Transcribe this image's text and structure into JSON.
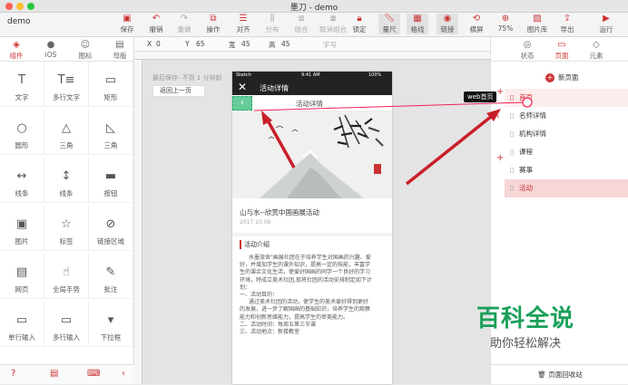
{
  "window": {
    "title": "墨刀 - demo",
    "project": "demo"
  },
  "toolbar": {
    "items": [
      {
        "label": "保存",
        "icon": "save-icon"
      },
      {
        "label": "撤销",
        "icon": "undo-icon"
      },
      {
        "label": "重做",
        "icon": "redo-icon"
      },
      {
        "label": "操作",
        "icon": "operate-icon"
      },
      {
        "label": "对齐",
        "icon": "align-icon"
      },
      {
        "label": "分布",
        "icon": "distribute-icon"
      },
      {
        "label": "组合",
        "icon": "group-icon"
      },
      {
        "label": "取消组合",
        "icon": "ungroup-icon"
      },
      {
        "label": "锁定",
        "icon": "lock-icon"
      },
      {
        "label": "量尺",
        "icon": "ruler-icon"
      },
      {
        "label": "格线",
        "icon": "grid-icon"
      },
      {
        "label": "链接",
        "icon": "link-icon"
      },
      {
        "label": "横屏",
        "icon": "rotate-icon"
      },
      {
        "label": "75%",
        "icon": "zoom-icon"
      },
      {
        "label": "图片库",
        "icon": "image-library-icon"
      },
      {
        "label": "导出",
        "icon": "export-icon"
      },
      {
        "label": "运行",
        "icon": "run-icon"
      }
    ]
  },
  "left_panel": {
    "tabs": [
      {
        "label": "组件",
        "icon": "component-icon"
      },
      {
        "label": "iOS",
        "icon": "apple-icon"
      },
      {
        "label": "图标",
        "icon": "emoji-icon"
      },
      {
        "label": "母版",
        "icon": "master-icon"
      }
    ],
    "components": [
      {
        "label": "文字",
        "icon": "T"
      },
      {
        "label": "多行文字",
        "icon": "T≡"
      },
      {
        "label": "矩形",
        "icon": "▭"
      },
      {
        "label": "圆形",
        "icon": "○"
      },
      {
        "label": "三角",
        "icon": "△"
      },
      {
        "label": "三角",
        "icon": "◺"
      },
      {
        "label": "线条",
        "icon": "↔"
      },
      {
        "label": "线条",
        "icon": "↕"
      },
      {
        "label": "按钮",
        "icon": "▬"
      },
      {
        "label": "图片",
        "icon": "▣"
      },
      {
        "label": "标签",
        "icon": "☆"
      },
      {
        "label": "链接区域",
        "icon": "⊘"
      },
      {
        "label": "网页",
        "icon": "▤"
      },
      {
        "label": "全局手势",
        "icon": "☝"
      },
      {
        "label": "批注",
        "icon": "✎"
      },
      {
        "label": "单行输入",
        "icon": "▭"
      },
      {
        "label": "多行输入",
        "icon": "▭"
      },
      {
        "label": "下拉框",
        "icon": "▾"
      }
    ],
    "footer_icons": [
      "help-icon",
      "document-icon",
      "keyboard-icon",
      "collapse-icon"
    ]
  },
  "properties": {
    "x_label": "X",
    "x": "0",
    "y_label": "Y",
    "y": "65",
    "w_label": "宽",
    "w": "45",
    "h_label": "高",
    "h": "45",
    "font_label": "字号"
  },
  "canvas": {
    "saved_text": "最后保存: 不到 1 分钟前",
    "back_button": "返回上一页"
  },
  "phone": {
    "carrier": "Sketch",
    "time": "9:41 AM",
    "battery": "100%",
    "nav_title": "活动详情",
    "header_label": "活动详情",
    "article_title": "山与水--欣赏中国画展活动",
    "article_date": "2017.10.08",
    "section_title": "活动介绍",
    "body_lines": [
      "水墨旅舍\"画展社团在于培养学生对国画的兴趣、爱",
      "好，并增加学生的课外知识，提高一定的技能，丰富学",
      "生的课余文化生活，使爱好国画的同学一个良好的学习",
      "环境，特成立美术社团,现将社团的活动安排制定如下计",
      "划：",
      "一、活动目的：",
      "通过美术社团的活动，使学生的美术爱好得到更好",
      "的发展，进一步了解国画的基础知识，培养学生的观察",
      "能力和创新思维能力，提高学生的审美能力。",
      "二、活动时间：每周五第三节课",
      "三、活动地点：新楼教室"
    ]
  },
  "right_panel": {
    "tabs": [
      {
        "label": "状态",
        "icon": "state-icon"
      },
      {
        "label": "页面",
        "icon": "page-icon"
      },
      {
        "label": "元素",
        "icon": "element-icon"
      }
    ],
    "new_page": "新页面",
    "pages": [
      "首页",
      "名师详情",
      "机构详情",
      "课程",
      "赛事",
      "活动"
    ],
    "selected_page": "活动",
    "link_tooltip": "web首页",
    "recycle_bin": "页面回收站"
  },
  "watermark": {
    "title": "百科全说",
    "subtitle": "助你轻松解决"
  }
}
